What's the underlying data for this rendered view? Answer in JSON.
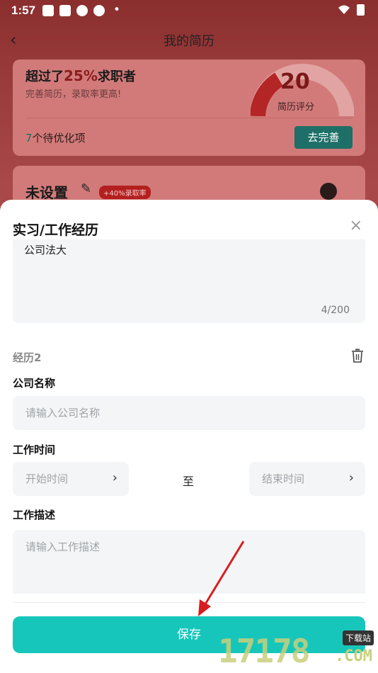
{
  "status_bar": {
    "time": "1:57",
    "dot": "•"
  },
  "nav": {
    "back": "‹",
    "title": "我的简历"
  },
  "score_card": {
    "headline_prefix": "超过了",
    "percent": "25%",
    "headline_suffix": "求职者",
    "subtitle": "完善简历，录取率更高!",
    "score": "20",
    "score_label": "简历评分",
    "pending_count": "7",
    "pending_text": "个待优化项",
    "improve_button": "去完善"
  },
  "name_card": {
    "name": "未设置",
    "badge": "+40%录取率"
  },
  "sheet": {
    "title": "实习/工作经历",
    "close": "×",
    "prev_description": {
      "value": "公司法大",
      "counter": "4/200"
    },
    "experience_label": "经历2",
    "company": {
      "label": "公司名称",
      "placeholder": "请输入公司名称"
    },
    "work_time": {
      "label": "工作时间",
      "start_placeholder": "开始时间",
      "to": "至",
      "end_placeholder": "结束时间",
      "chevron": "›"
    },
    "description": {
      "label": "工作描述",
      "placeholder": "请输入工作描述"
    },
    "save_button": "保存"
  },
  "watermark": {
    "digits": "17178",
    "tag": "下载站",
    "domain": ".COM"
  },
  "colors": {
    "accent": "#17c6ba",
    "arrow": "#d81e1e",
    "overlay": "#8b2e2e"
  }
}
